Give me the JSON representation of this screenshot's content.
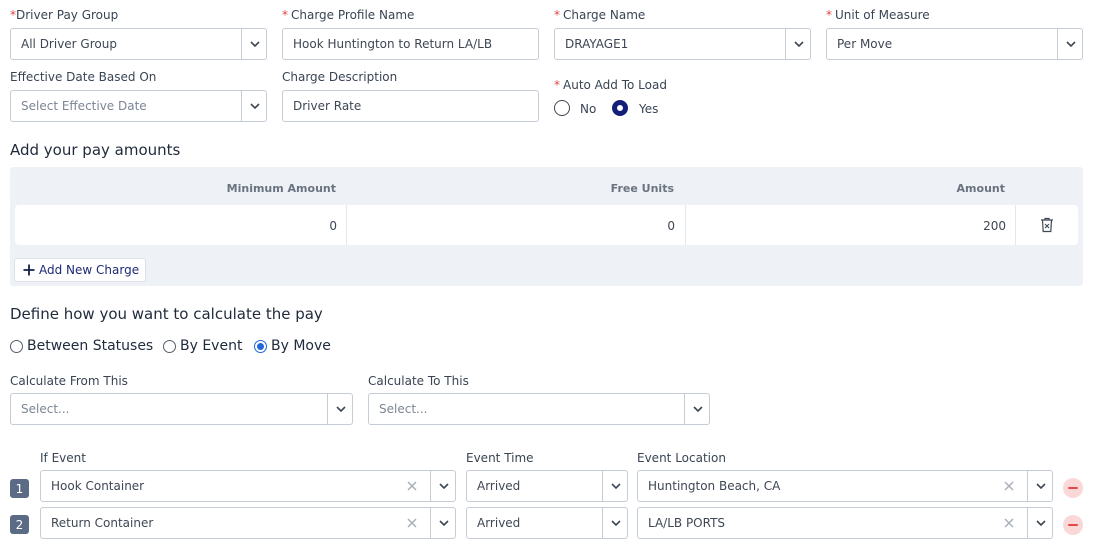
{
  "form": {
    "driver_pay_group": {
      "label": "Driver Pay Group",
      "value": "All Driver Group"
    },
    "charge_profile_name": {
      "label": "Charge Profile Name",
      "value": "Hook Huntington to Return LA/LB"
    },
    "charge_name": {
      "label": "Charge Name",
      "value": "DRAYAGE1"
    },
    "unit_of_measure": {
      "label": "Unit of Measure",
      "value": "Per Move"
    },
    "effective_date": {
      "label": "Effective Date Based On",
      "placeholder": "Select Effective Date"
    },
    "charge_description": {
      "label": "Charge Description",
      "value": "Driver Rate"
    },
    "auto_add": {
      "label": "Auto Add To Load",
      "options": [
        "No",
        "Yes"
      ],
      "selected": "Yes"
    },
    "required_marker": "*"
  },
  "pay_amounts": {
    "title": "Add your pay amounts",
    "columns": [
      "Minimum Amount",
      "Free Units",
      "Amount"
    ],
    "rows": [
      {
        "minimum": "0",
        "free_units": "0",
        "amount": "200"
      }
    ],
    "add_label": "Add New Charge"
  },
  "calculation": {
    "title": "Define how you want to calculate the pay",
    "methods": [
      "Between Statuses",
      "By Event",
      "By Move"
    ],
    "selected_method": "By Move",
    "from_label": "Calculate From This",
    "from_placeholder": "Select...",
    "to_label": "Calculate To This",
    "to_placeholder": "Select..."
  },
  "events": {
    "headers": {
      "event": "If Event",
      "time": "Event Time",
      "location": "Event Location"
    },
    "rows": [
      {
        "num": "1",
        "event": "Hook Container",
        "time": "Arrived",
        "location": "Huntington Beach, CA"
      },
      {
        "num": "2",
        "event": "Return Container",
        "time": "Arrived",
        "location": "LA/LB PORTS"
      }
    ]
  },
  "icons": [
    "chevron-down-icon",
    "close-icon",
    "trash-icon",
    "plus-icon",
    "minus-icon"
  ],
  "colors": {
    "accent": "#141f77",
    "required": "#e0494a",
    "remove": "#fbd8d8",
    "radio_selected": "#2067d8"
  }
}
